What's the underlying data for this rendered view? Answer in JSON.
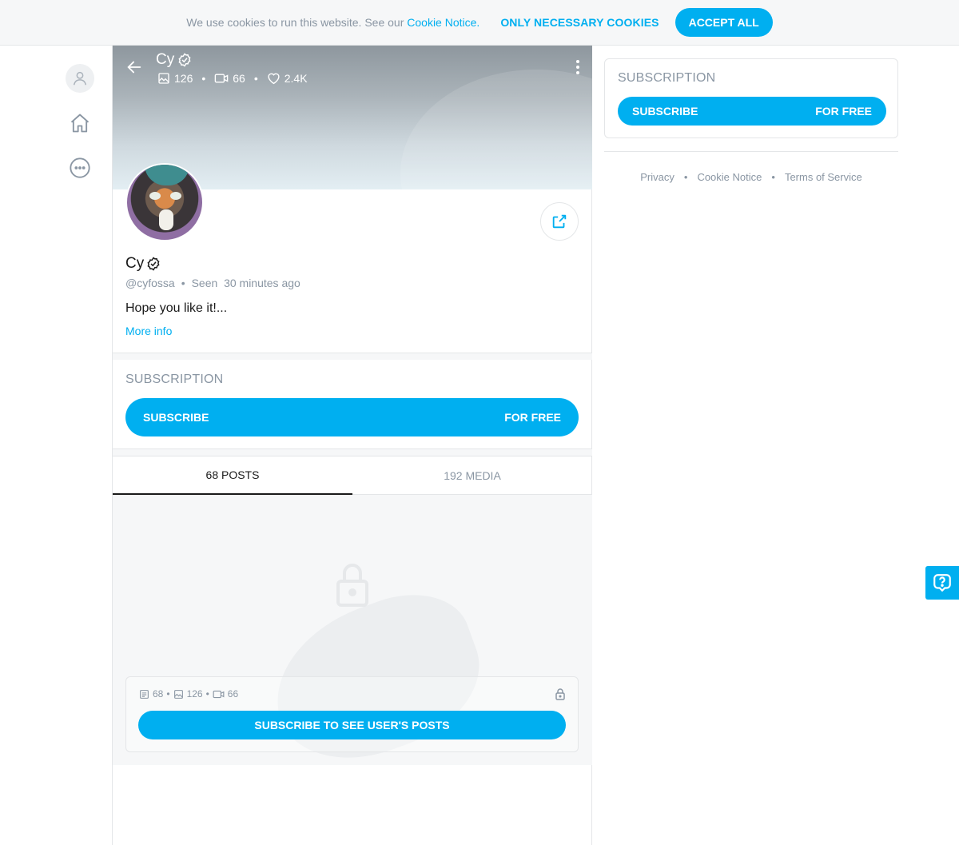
{
  "cookie": {
    "message": "We use cookies to run this website. See our ",
    "link": "Cookie Notice.",
    "necessary": "ONLY NECESSARY COOKIES",
    "accept": "ACCEPT ALL"
  },
  "header": {
    "name": "Cy",
    "stats": {
      "photos": "126",
      "videos": "66",
      "likes": "2.4K"
    }
  },
  "profile": {
    "name": "Cy",
    "handle": "@cyfossa",
    "seen": "Seen  30 minutes ago",
    "bio": "Hope you like it!...",
    "more_info": "More info"
  },
  "subscription": {
    "heading": "SUBSCRIPTION",
    "button_left": "SUBSCRIBE",
    "button_right": "FOR FREE"
  },
  "tabs": [
    {
      "label": "68 POSTS",
      "active": true
    },
    {
      "label": "192 MEDIA",
      "active": false
    }
  ],
  "locked": {
    "posts": "68",
    "photos": "126",
    "videos": "66",
    "button": "SUBSCRIBE TO SEE USER'S POSTS"
  },
  "sidebar_right": {
    "heading": "SUBSCRIPTION",
    "button_left": "SUBSCRIBE",
    "button_right": "FOR FREE"
  },
  "footer": {
    "privacy": "Privacy",
    "cookie": "Cookie Notice",
    "terms": "Terms of Service"
  },
  "colors": {
    "accent": "#00aff0",
    "muted": "#8a96a3",
    "border": "#e4e6e8"
  }
}
